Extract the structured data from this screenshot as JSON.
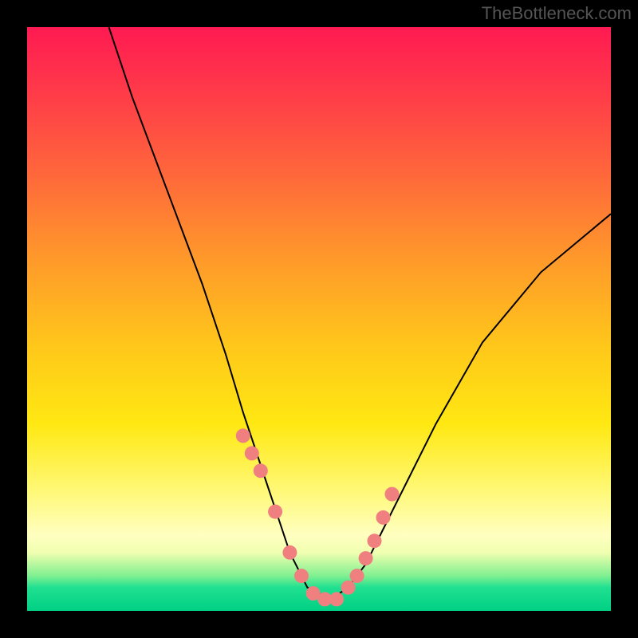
{
  "watermark": "TheBottleneck.com",
  "chart_data": {
    "type": "line",
    "title": "",
    "xlabel": "",
    "ylabel": "",
    "xlim": [
      0,
      100
    ],
    "ylim": [
      0,
      100
    ],
    "series": [
      {
        "name": "curve",
        "x": [
          14,
          18,
          24,
          30,
          34,
          37,
          39,
          41,
          43,
          45,
          48,
          52,
          55,
          58,
          61,
          65,
          70,
          78,
          88,
          100
        ],
        "values": [
          100,
          88,
          72,
          56,
          44,
          34,
          28,
          22,
          16,
          10,
          4,
          2,
          4,
          8,
          14,
          22,
          32,
          46,
          58,
          68
        ]
      }
    ],
    "markers": {
      "x": [
        37,
        38.5,
        40,
        42.5,
        45,
        47,
        49,
        51,
        53,
        55,
        56.5,
        58,
        59.5,
        61,
        62.5
      ],
      "values": [
        30,
        27,
        24,
        17,
        10,
        6,
        3,
        2,
        2,
        4,
        6,
        9,
        12,
        16,
        20
      ]
    }
  }
}
